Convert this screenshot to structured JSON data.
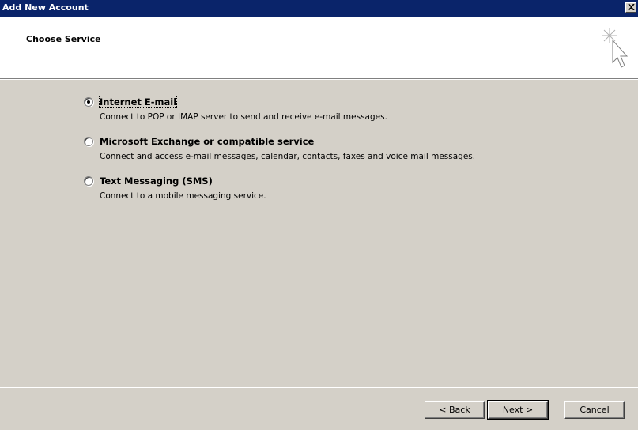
{
  "window": {
    "title": "Add New Account",
    "close_glyph": "×"
  },
  "header": {
    "title": "Choose Service",
    "icon": "sparkle-cursor-icon"
  },
  "options": [
    {
      "label": "Internet E-mail",
      "description": "Connect to POP or IMAP server to send and receive e-mail messages.",
      "selected": true
    },
    {
      "label": "Microsoft Exchange or compatible service",
      "description": "Connect and access e-mail messages, calendar, contacts, faxes and voice mail messages.",
      "selected": false
    },
    {
      "label": "Text Messaging (SMS)",
      "description": "Connect to a mobile messaging service.",
      "selected": false
    }
  ],
  "buttons": {
    "back": "< Back",
    "next": "Next >",
    "cancel": "Cancel"
  },
  "colors": {
    "titlebar": "#0a246a",
    "dialog_bg": "#d4d0c8",
    "header_bg": "#ffffff"
  }
}
